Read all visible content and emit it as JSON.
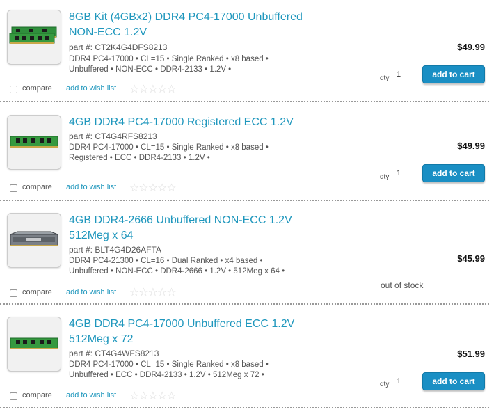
{
  "products": [
    {
      "title": "8GB Kit (4GBx2) DDR4 PC4-17000 Unbuffered NON-ECC 1.2V",
      "part": "part #:  CT2K4G4DFS8213",
      "specs": "DDR4 PC4-17000 • CL=15 • Single Ranked • x8 based • Unbuffered • NON-ECC • DDR4-2133 • 1.2V •",
      "price": "$49.99",
      "qty_label": "qty",
      "qty_value": "1",
      "button_label": "add to cart",
      "compare_label": "compare",
      "wish_label": "add to wish list",
      "stars": "☆☆☆☆☆",
      "module_icon": "ram-kit-green"
    },
    {
      "title": "4GB DDR4 PC4-17000 Registered ECC 1.2V",
      "part": "part #:  CT4G4RFS8213",
      "specs": "DDR4 PC4-17000 • CL=15 • Single Ranked • x8 based • Registered • ECC • DDR4-2133 • 1.2V •",
      "price": "$49.99",
      "qty_label": "qty",
      "qty_value": "1",
      "button_label": "add to cart",
      "compare_label": "compare",
      "wish_label": "add to wish list",
      "stars": "☆☆☆☆☆",
      "module_icon": "ram-module-green"
    },
    {
      "title": "4GB DDR4-2666 Unbuffered NON-ECC 1.2V 512Meg x 64",
      "part": "part #:  BLT4G4D26AFTA",
      "specs": "DDR4 PC4-21300 • CL=16 • Dual Ranked • x4 based • Unbuffered • NON-ECC • DDR4-2666 • 1.2V • 512Meg x 64 •",
      "price": "$45.99",
      "stock_status": "out of stock",
      "compare_label": "compare",
      "wish_label": "add to wish list",
      "stars": "☆☆☆☆☆",
      "module_icon": "ram-module-heatspreader-gray"
    },
    {
      "title": "4GB DDR4 PC4-17000 Unbuffered ECC 1.2V 512Meg x 72",
      "part": "part #:  CT4G4WFS8213",
      "specs": "DDR4 PC4-17000 • CL=15 • Single Ranked • x8 based • Unbuffered • ECC • DDR4-2133 • 1.2V • 512Meg x 72 •",
      "price": "$51.99",
      "qty_label": "qty",
      "qty_value": "1",
      "button_label": "add to cart",
      "compare_label": "compare",
      "wish_label": "add to wish list",
      "stars": "☆☆☆☆☆",
      "module_icon": "ram-module-green"
    }
  ],
  "colors": {
    "link": "#1f97bd",
    "button": "#1a8fc4",
    "pcb_green": "#2f8f3c"
  }
}
